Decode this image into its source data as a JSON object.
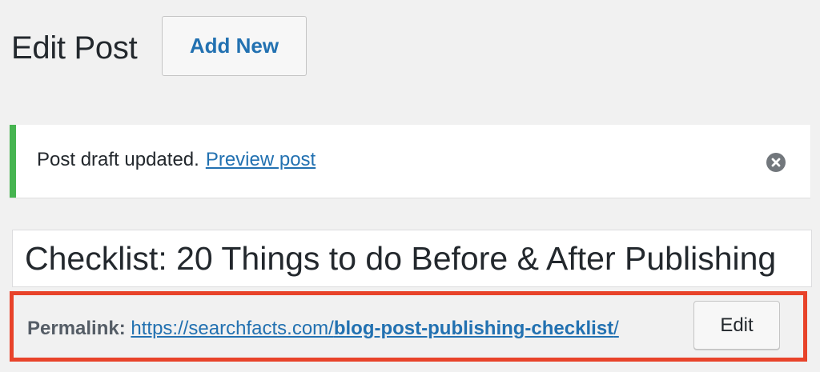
{
  "header": {
    "title": "Edit Post",
    "add_new_label": "Add New"
  },
  "notice": {
    "message": "Post draft updated.",
    "link_text": "Preview post",
    "dismiss_icon": "dismiss-icon",
    "accent_color": "#46b450"
  },
  "post": {
    "title": "Checklist: 20 Things to do Before & After Publishing"
  },
  "permalink": {
    "label": "Permalink:",
    "base_url": "https://searchfacts.com/",
    "slug": "blog-post-publishing-checklist",
    "trailing": "/",
    "edit_label": "Edit",
    "highlight_color": "#e8432a"
  },
  "colors": {
    "link": "#2271b1",
    "background": "#f1f1f1"
  }
}
